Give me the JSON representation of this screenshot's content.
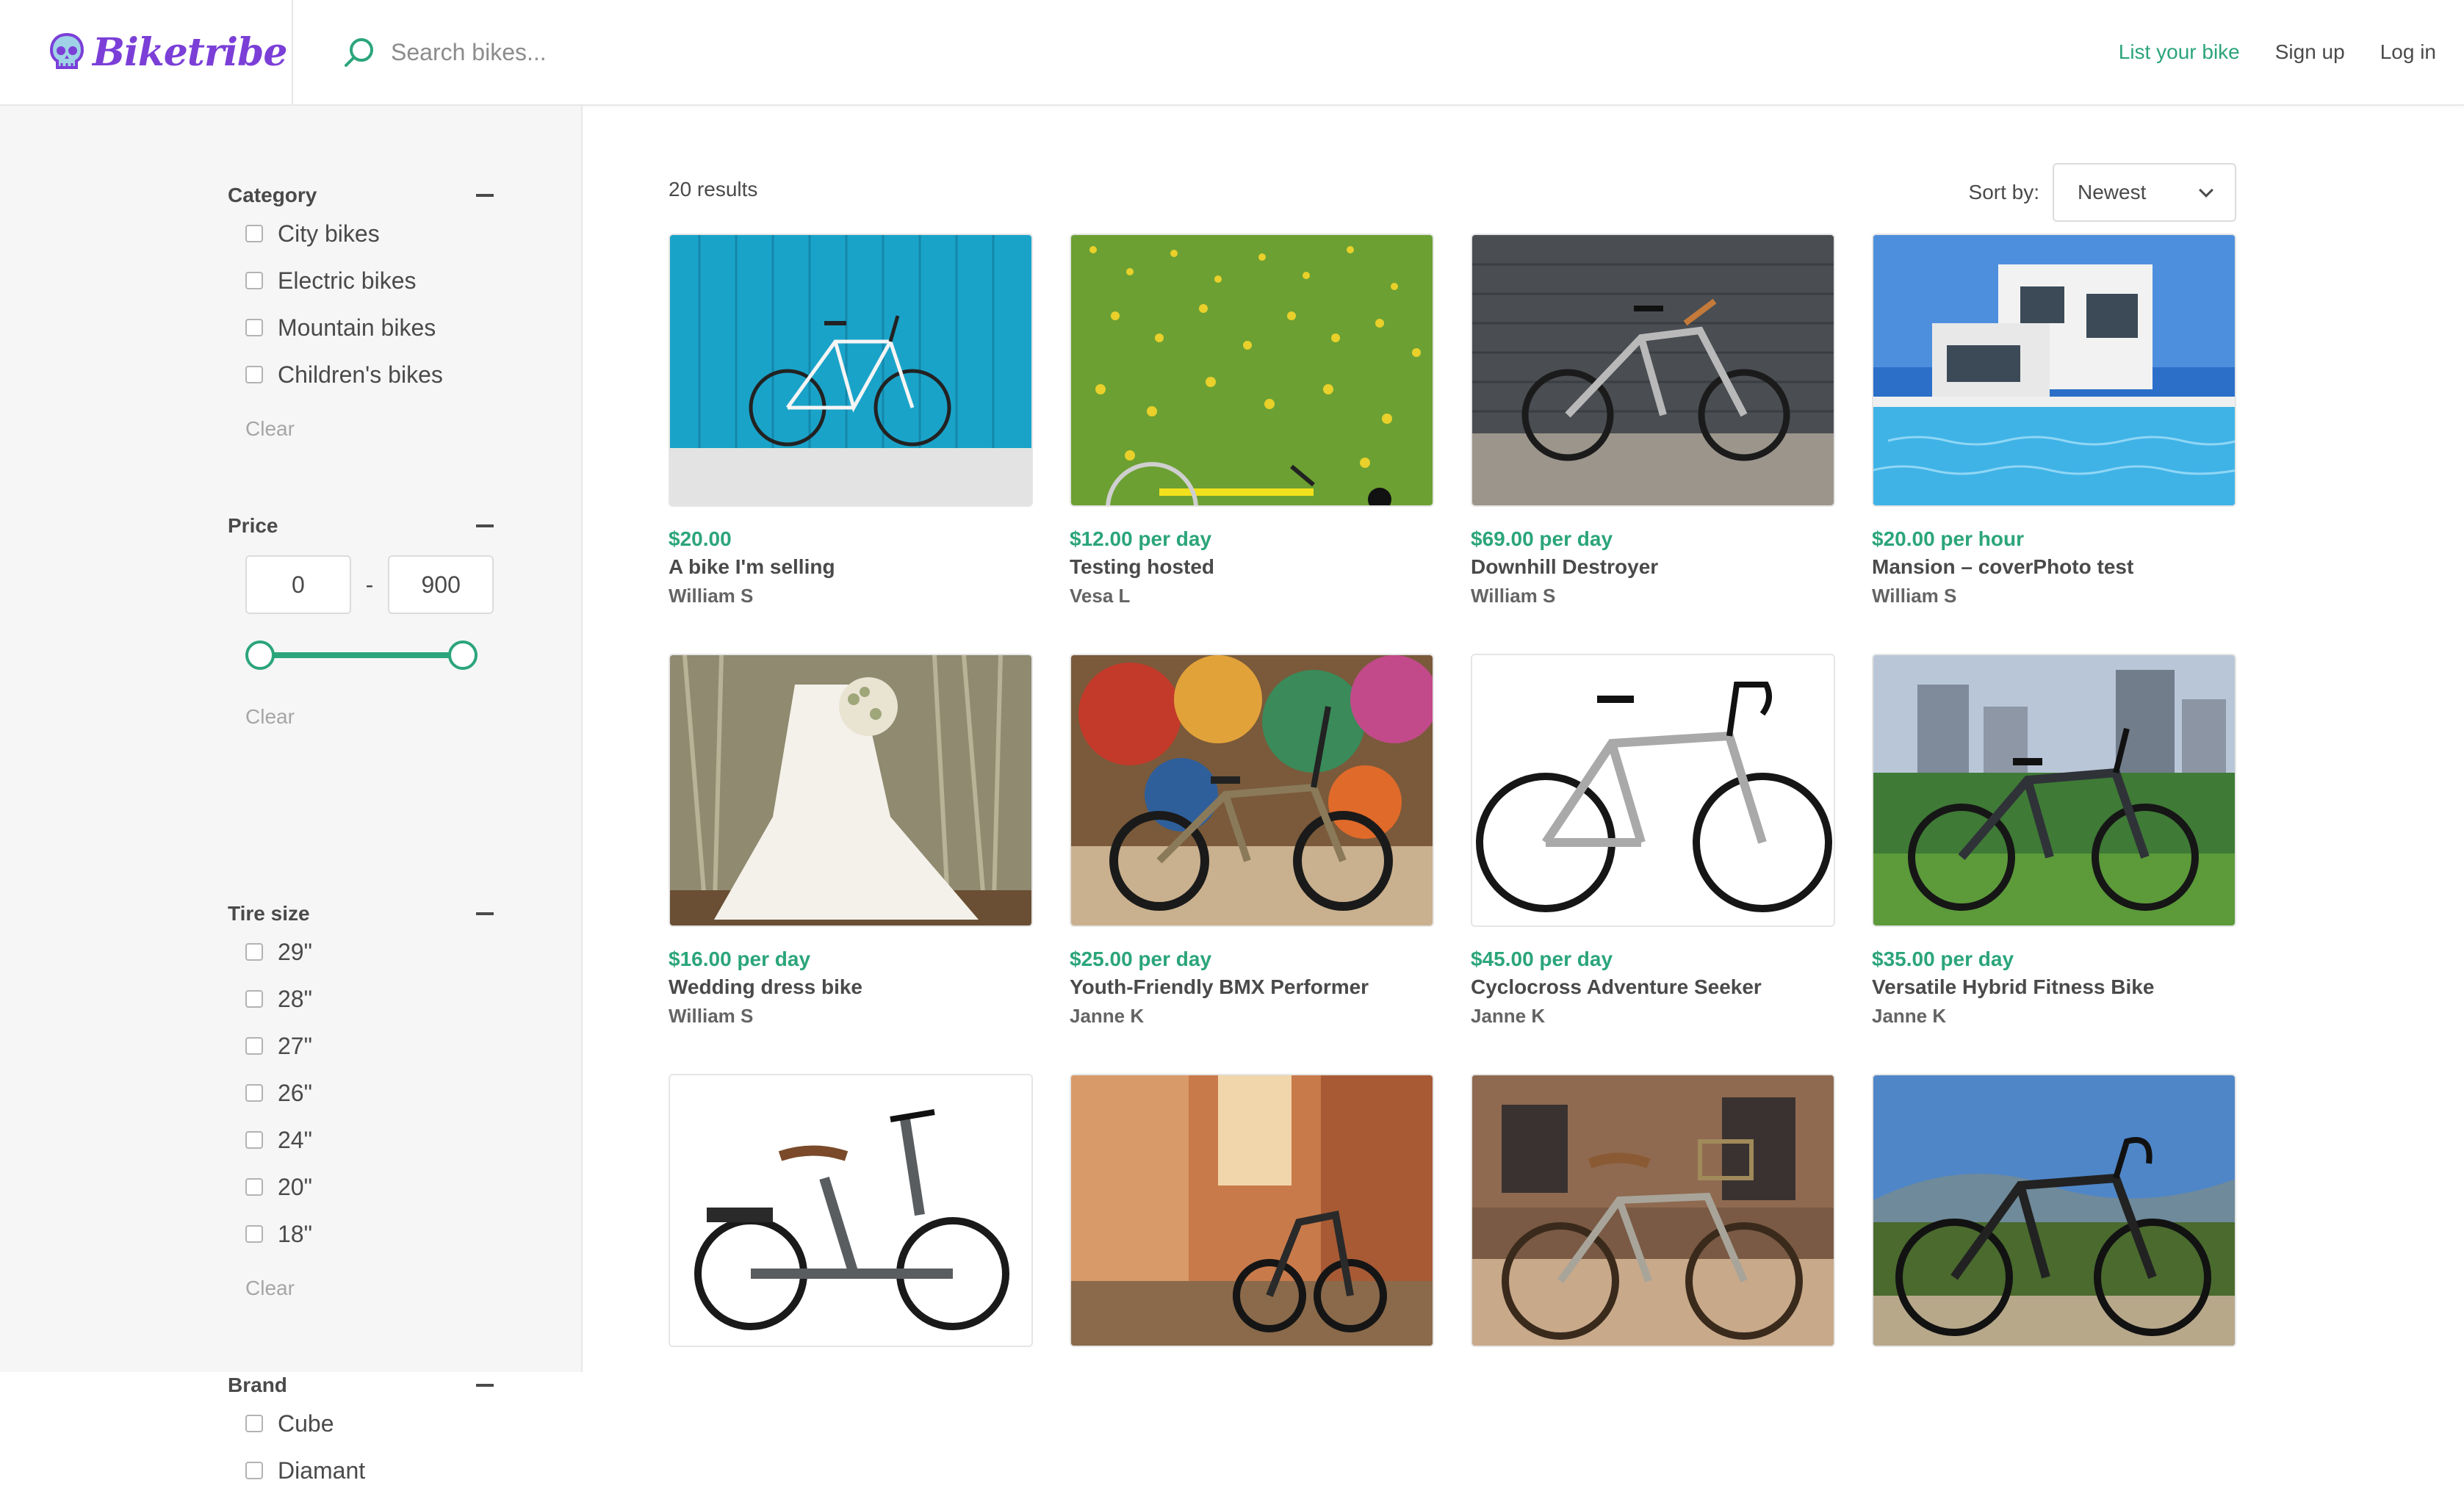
{
  "brand": {
    "name": "Biketribe",
    "logo_icon": "skull-logo-icon",
    "accent": "#2ba57a",
    "logo_color": "#7b3fd8"
  },
  "search": {
    "placeholder": "Search bikes...",
    "icon": "search-icon"
  },
  "nav": {
    "list_bike": "List your bike",
    "sign_up": "Sign up",
    "log_in": "Log in"
  },
  "filters": {
    "category": {
      "title": "Category",
      "options": [
        "City bikes",
        "Electric bikes",
        "Mountain bikes",
        "Children's bikes"
      ],
      "clear": "Clear"
    },
    "price": {
      "title": "Price",
      "min": "0",
      "max": "900",
      "separator": "-",
      "range_fraction": [
        0,
        1
      ],
      "clear": "Clear"
    },
    "tire_size": {
      "title": "Tire size",
      "options": [
        "29\"",
        "28\"",
        "27\"",
        "26\"",
        "24\"",
        "20\"",
        "18\""
      ],
      "clear": "Clear"
    },
    "brand": {
      "title": "Brand",
      "options": [
        "Cube",
        "Diamant"
      ]
    }
  },
  "results": {
    "count_label": "20 results"
  },
  "sort": {
    "label": "Sort by:",
    "value": "Newest"
  },
  "listings": [
    {
      "price": "$20.00",
      "unit": "",
      "title": "A bike I'm selling",
      "author": "William S"
    },
    {
      "price": "$12.00",
      "unit": "per day",
      "title": "Testing hosted",
      "author": "Vesa L"
    },
    {
      "price": "$69.00",
      "unit": "per day",
      "title": "Downhill Destroyer",
      "author": "William S"
    },
    {
      "price": "$20.00",
      "unit": "per hour",
      "title": "Mansion – coverPhoto test",
      "author": "William S"
    },
    {
      "price": "$16.00",
      "unit": "per day",
      "title": "Wedding dress bike",
      "author": "William S"
    },
    {
      "price": "$25.00",
      "unit": "per day",
      "title": "Youth-Friendly BMX Performer",
      "author": "Janne K"
    },
    {
      "price": "$45.00",
      "unit": "per day",
      "title": "Cyclocross Adventure Seeker",
      "author": "Janne K"
    },
    {
      "price": "$35.00",
      "unit": "per day",
      "title": "Versatile Hybrid Fitness Bike",
      "author": "Janne K"
    },
    {
      "price": "",
      "unit": "",
      "title": "",
      "author": ""
    },
    {
      "price": "",
      "unit": "",
      "title": "",
      "author": ""
    },
    {
      "price": "",
      "unit": "",
      "title": "",
      "author": ""
    },
    {
      "price": "",
      "unit": "",
      "title": "",
      "author": ""
    }
  ]
}
